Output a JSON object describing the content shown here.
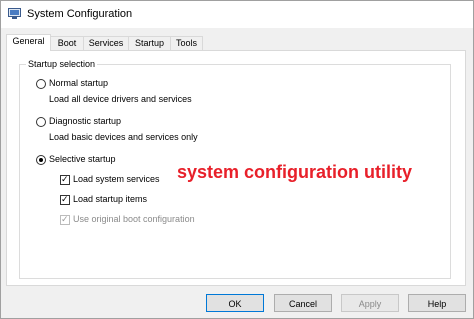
{
  "window": {
    "title": "System Configuration",
    "icon": "msconfig-icon"
  },
  "tabs": [
    {
      "label": "General",
      "active": true
    },
    {
      "label": "Boot",
      "active": false
    },
    {
      "label": "Services",
      "active": false
    },
    {
      "label": "Startup",
      "active": false
    },
    {
      "label": "Tools",
      "active": false
    }
  ],
  "startup_selection": {
    "group_label": "Startup selection",
    "normal": {
      "label": "Normal startup",
      "description": "Load all device drivers and services",
      "selected": false
    },
    "diagnostic": {
      "label": "Diagnostic startup",
      "description": "Load basic devices and services only",
      "selected": false
    },
    "selective": {
      "label": "Selective startup",
      "selected": true,
      "options": {
        "load_system_services": {
          "label": "Load system services",
          "checked": true,
          "enabled": true
        },
        "load_startup_items": {
          "label": "Load startup items",
          "checked": true,
          "enabled": true
        },
        "use_original_boot": {
          "label": "Use original boot configuration",
          "checked": true,
          "enabled": false
        }
      }
    }
  },
  "annotation": {
    "text": "system configuration utility",
    "color": "#e8202a"
  },
  "buttons": {
    "ok": "OK",
    "cancel": "Cancel",
    "apply": "Apply",
    "help": "Help"
  },
  "colors": {
    "accent": "#0078d7",
    "window_bg": "#f0f0f0",
    "tab_page_bg": "#ffffff"
  }
}
